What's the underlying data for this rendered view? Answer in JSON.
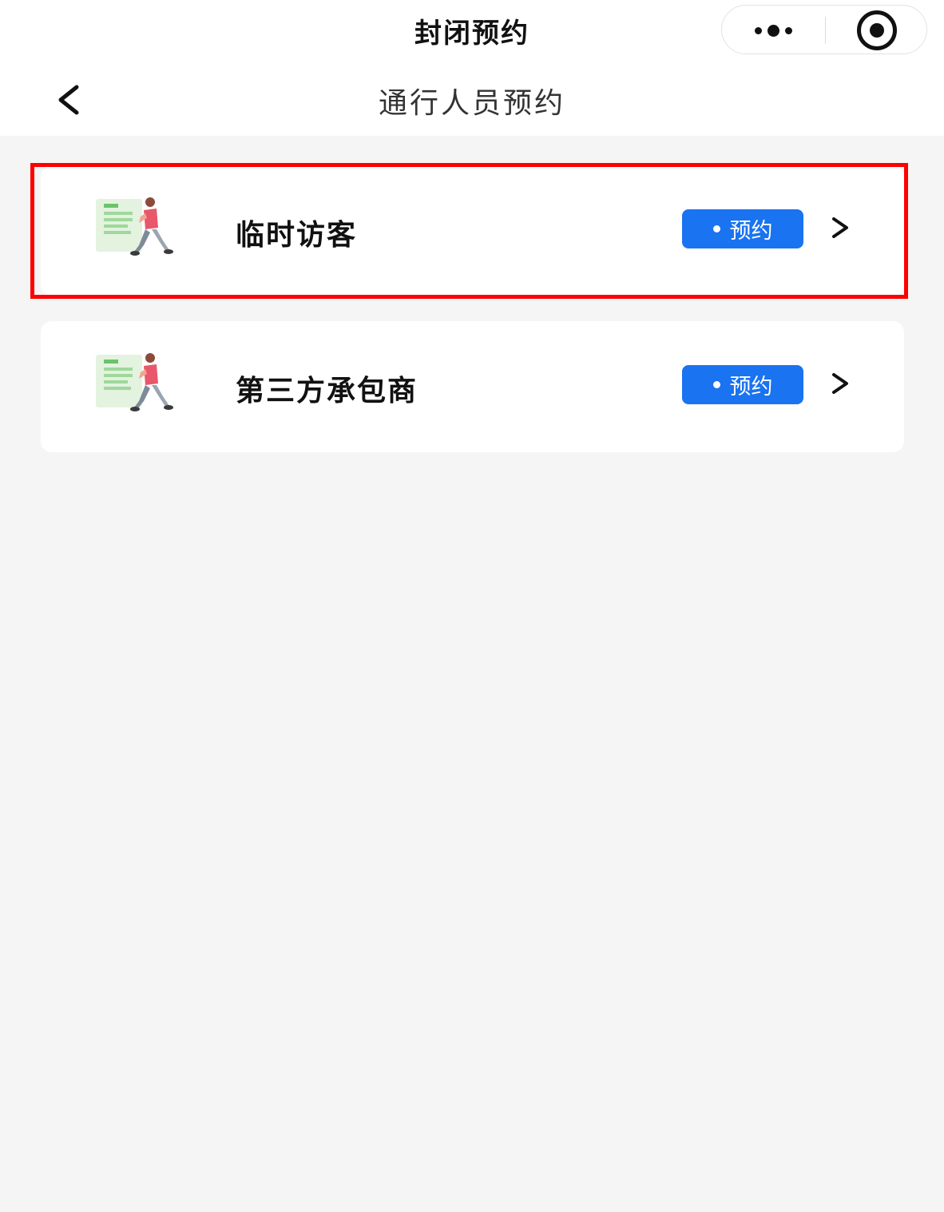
{
  "app": {
    "title": "封闭预约"
  },
  "capsule": {
    "more_icon": "more-dots-icon",
    "close_icon": "target-close-icon"
  },
  "nav": {
    "back_icon": "chevron-left-icon",
    "title": "通行人员预约"
  },
  "list": {
    "items": [
      {
        "label": "临时访客",
        "button_label": "预约",
        "icon": "visitor-walking-icon",
        "highlighted": true
      },
      {
        "label": "第三方承包商",
        "button_label": "预约",
        "icon": "visitor-walking-icon",
        "highlighted": false
      }
    ]
  },
  "colors": {
    "accent": "#1a73f0",
    "background": "#f5f5f5",
    "highlight": "#ff0000"
  }
}
